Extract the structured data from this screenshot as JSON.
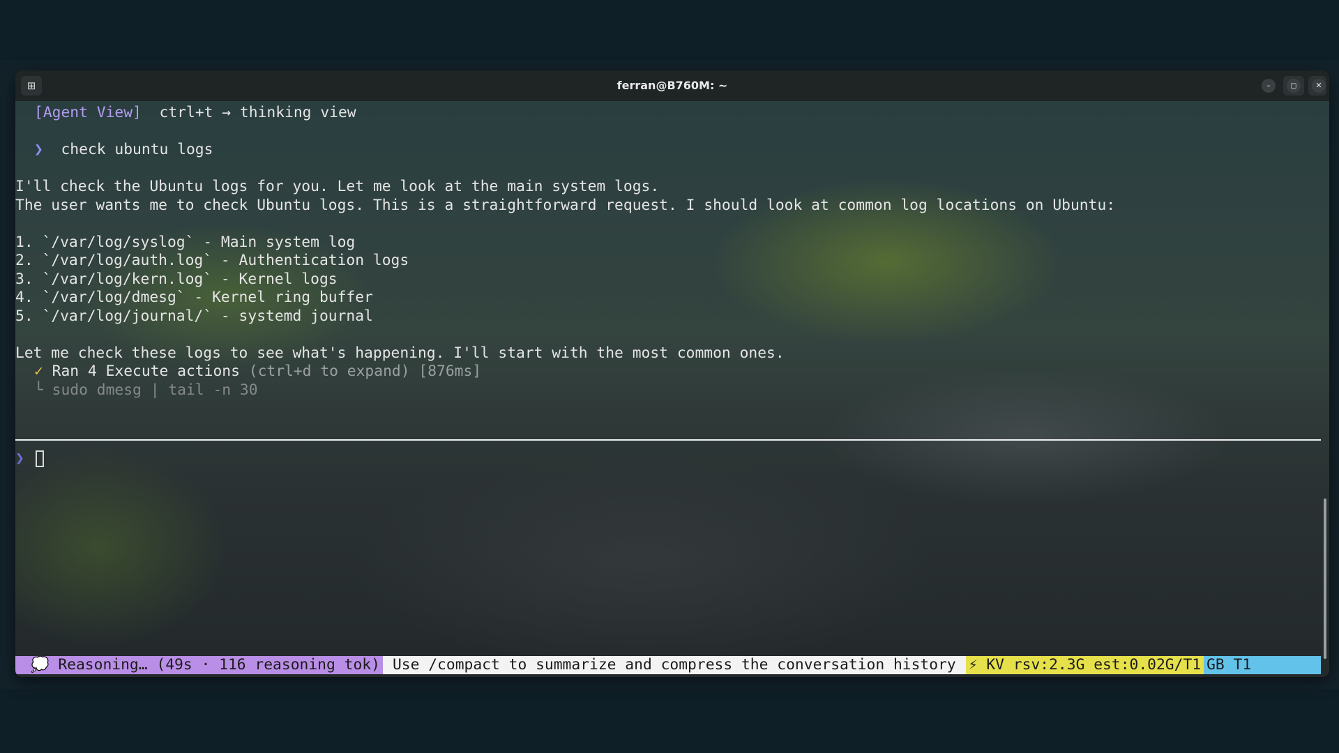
{
  "window": {
    "title": "ferran@B760M: ~",
    "icons": {
      "new_tab": "terminal-new-tab-icon",
      "search": "search-icon",
      "menu": "kebab-menu-icon",
      "minimize": "minimize-icon",
      "maximize": "maximize-icon",
      "close": "close-icon"
    }
  },
  "header": {
    "view_label": "[Agent View]",
    "view_hint": "ctrl+t → thinking view"
  },
  "user_message": {
    "chevron": "❯",
    "text": "check ubuntu logs"
  },
  "assistant": {
    "intro": "I'll check the Ubuntu logs for you. Let me look at the main system logs.",
    "thinking": "The user wants me to check Ubuntu logs. This is a straightforward request. I should look at common log locations on Ubuntu:",
    "list": [
      "1. `/var/log/syslog` - Main system log",
      "2. `/var/log/auth.log` - Authentication logs",
      "3. `/var/log/kern.log` - Kernel logs",
      "4. `/var/log/dmesg` - Kernel ring buffer",
      "5. `/var/log/journal/` - systemd journal"
    ],
    "closing": "Let me check these logs to see what's happening. I'll start with the most common ones."
  },
  "tool": {
    "check": "✓",
    "label": "Ran 4 Execute actions",
    "expand_hint": "(ctrl+d to expand)",
    "duration": "[876ms]",
    "tree_glyph": "└",
    "command": "sudo dmesg | tail -n 30"
  },
  "prompt": {
    "chevron": "❯",
    "value": ""
  },
  "status_bar": {
    "reasoning": "💭 Reasoning… (49s · 116 reasoning tok)",
    "hint": "Use /compact to summarize and compress the conversation history",
    "kv": "⚡ KV rsv:2.3G est:0.02G/T1",
    "gb": "GB T1"
  },
  "colors": {
    "agent_view": "#b39df0",
    "reasoning_bg": "#b98ee6",
    "hint_bg": "#f3f3f3",
    "kv_bg": "#e6e04a",
    "gb_bg": "#63c2ea",
    "check": "#e6c44a"
  }
}
